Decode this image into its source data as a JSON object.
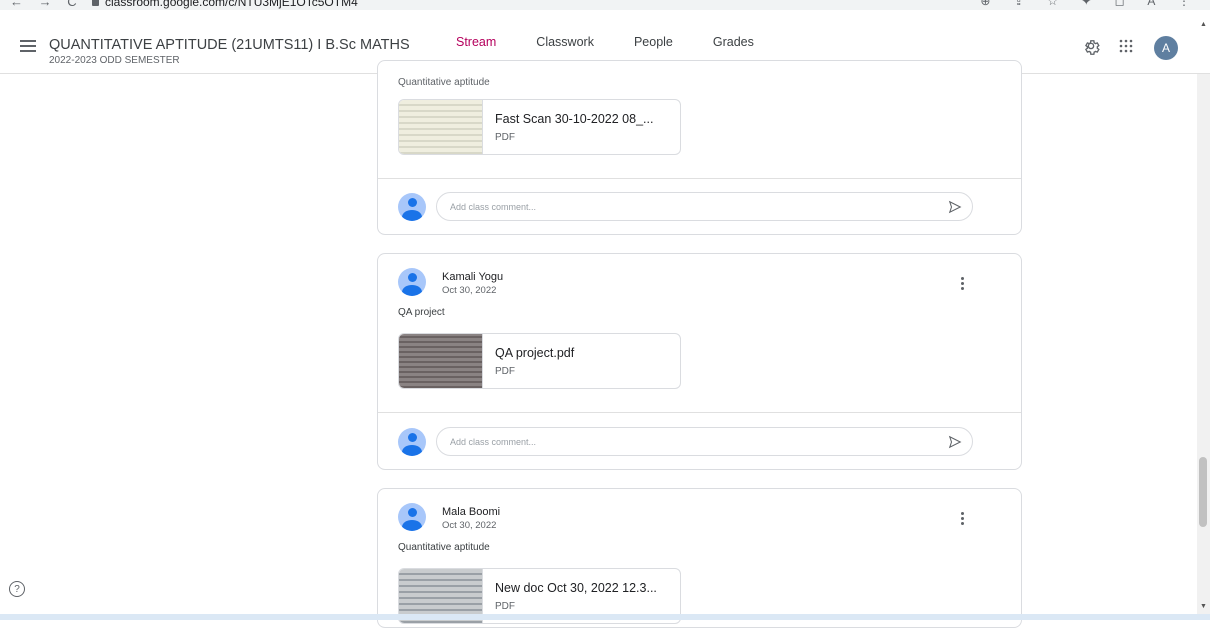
{
  "browser": {
    "nav_icons": "← → C",
    "url": "classroom.google.com/c/NTU3MjE1OTc5OTM4",
    "right_icons": "⊕ ⇪ ☆ ✦ ◻ A ⋮"
  },
  "header": {
    "class_title": "QUANTITATIVE APTITUDE (21UMTS11) I B.Sc MATHS",
    "class_subtitle": "2022-2023 ODD SEMESTER",
    "tabs": [
      {
        "label": "Stream",
        "active": true
      },
      {
        "label": "Classwork",
        "active": false
      },
      {
        "label": "People",
        "active": false
      },
      {
        "label": "Grades",
        "active": false
      }
    ],
    "avatar_letter": "A",
    "accent_color": "#b5005d"
  },
  "posts": [
    {
      "text": "Quantitative aptitude",
      "attachment": {
        "name": "Fast Scan 30-10-2022 08_...",
        "type": "PDF"
      },
      "comment_placeholder": "Add class comment..."
    },
    {
      "author": "Kamali Yogu",
      "date": "Oct 30, 2022",
      "text": "QA project",
      "attachment": {
        "name": "QA project.pdf",
        "type": "PDF"
      },
      "comment_placeholder": "Add class comment..."
    },
    {
      "author": "Mala Boomi",
      "date": "Oct 30, 2022",
      "text": "Quantitative aptitude",
      "attachment": {
        "name": "New doc Oct 30, 2022 12.3...",
        "type": "PDF"
      }
    }
  ],
  "help_icon_glyph": "?"
}
